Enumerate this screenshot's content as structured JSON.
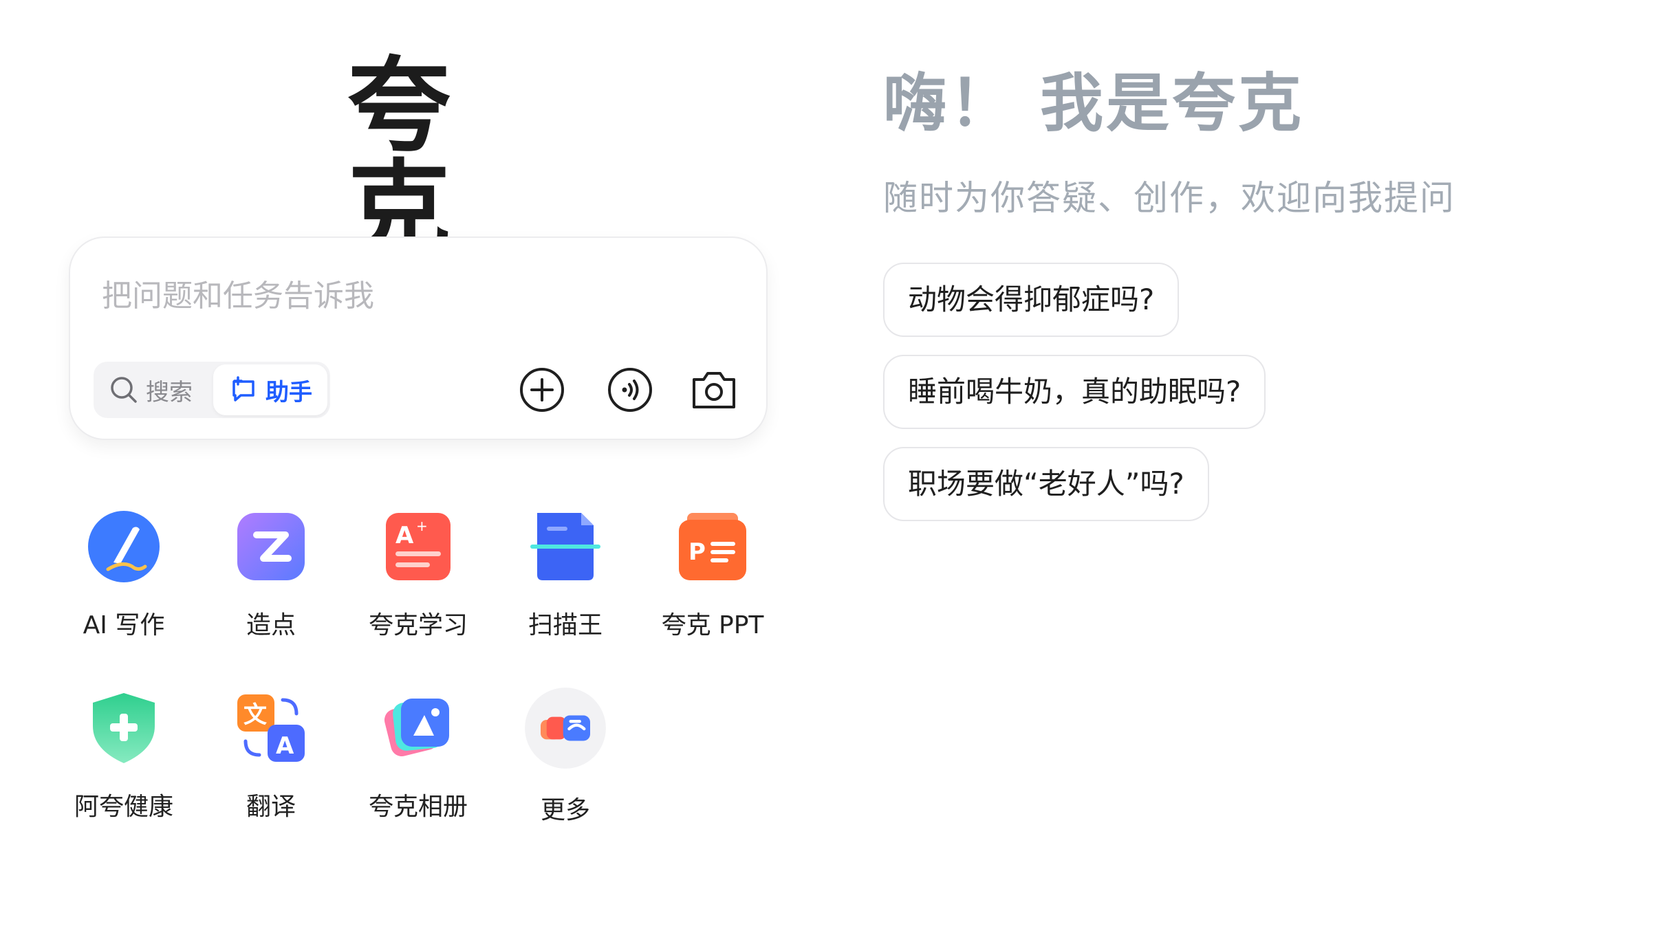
{
  "brand": {
    "logo_text": "夸 克"
  },
  "search": {
    "placeholder": "把问题和任务告诉我",
    "modes": {
      "search_label": "搜索",
      "assistant_label": "助手",
      "active": "assistant"
    },
    "actions": [
      {
        "icon": "add-circle-icon"
      },
      {
        "icon": "voice-icon"
      },
      {
        "icon": "camera-icon"
      }
    ]
  },
  "apps": [
    {
      "label": "AI 写作",
      "icon": "ai-writing-icon",
      "color": "#3d7bff"
    },
    {
      "label": "造点",
      "icon": "zaodian-icon",
      "color": "#8b6cff"
    },
    {
      "label": "夸克学习",
      "icon": "study-icon",
      "color": "#ff5a4e"
    },
    {
      "label": "扫描王",
      "icon": "scanner-icon",
      "color": "#3c64f5"
    },
    {
      "label": "夸克 PPT",
      "icon": "ppt-icon",
      "color": "#ff6a30"
    },
    {
      "label": "阿夸健康",
      "icon": "health-shield-icon",
      "color": "#2fcf8e"
    },
    {
      "label": "翻译",
      "icon": "translate-icon",
      "color": "#4d6bff"
    },
    {
      "label": "夸克相册",
      "icon": "album-icon",
      "color": "#4a7bff"
    },
    {
      "label": "更多",
      "icon": "more-apps-icon",
      "color": "#f2f2f4"
    }
  ],
  "greeting": {
    "title": "嗨！ 我是夸克",
    "subtitle": "随时为你答疑、创作，欢迎向我提问"
  },
  "suggestions": [
    "动物会得抑郁症吗?",
    "睡前喝牛奶，真的助眠吗?",
    "职场要做“老好人”吗?"
  ],
  "colors": {
    "accent": "#1f5dff",
    "greeting_text": "#9aa3ad",
    "placeholder": "#b8b8bc"
  }
}
